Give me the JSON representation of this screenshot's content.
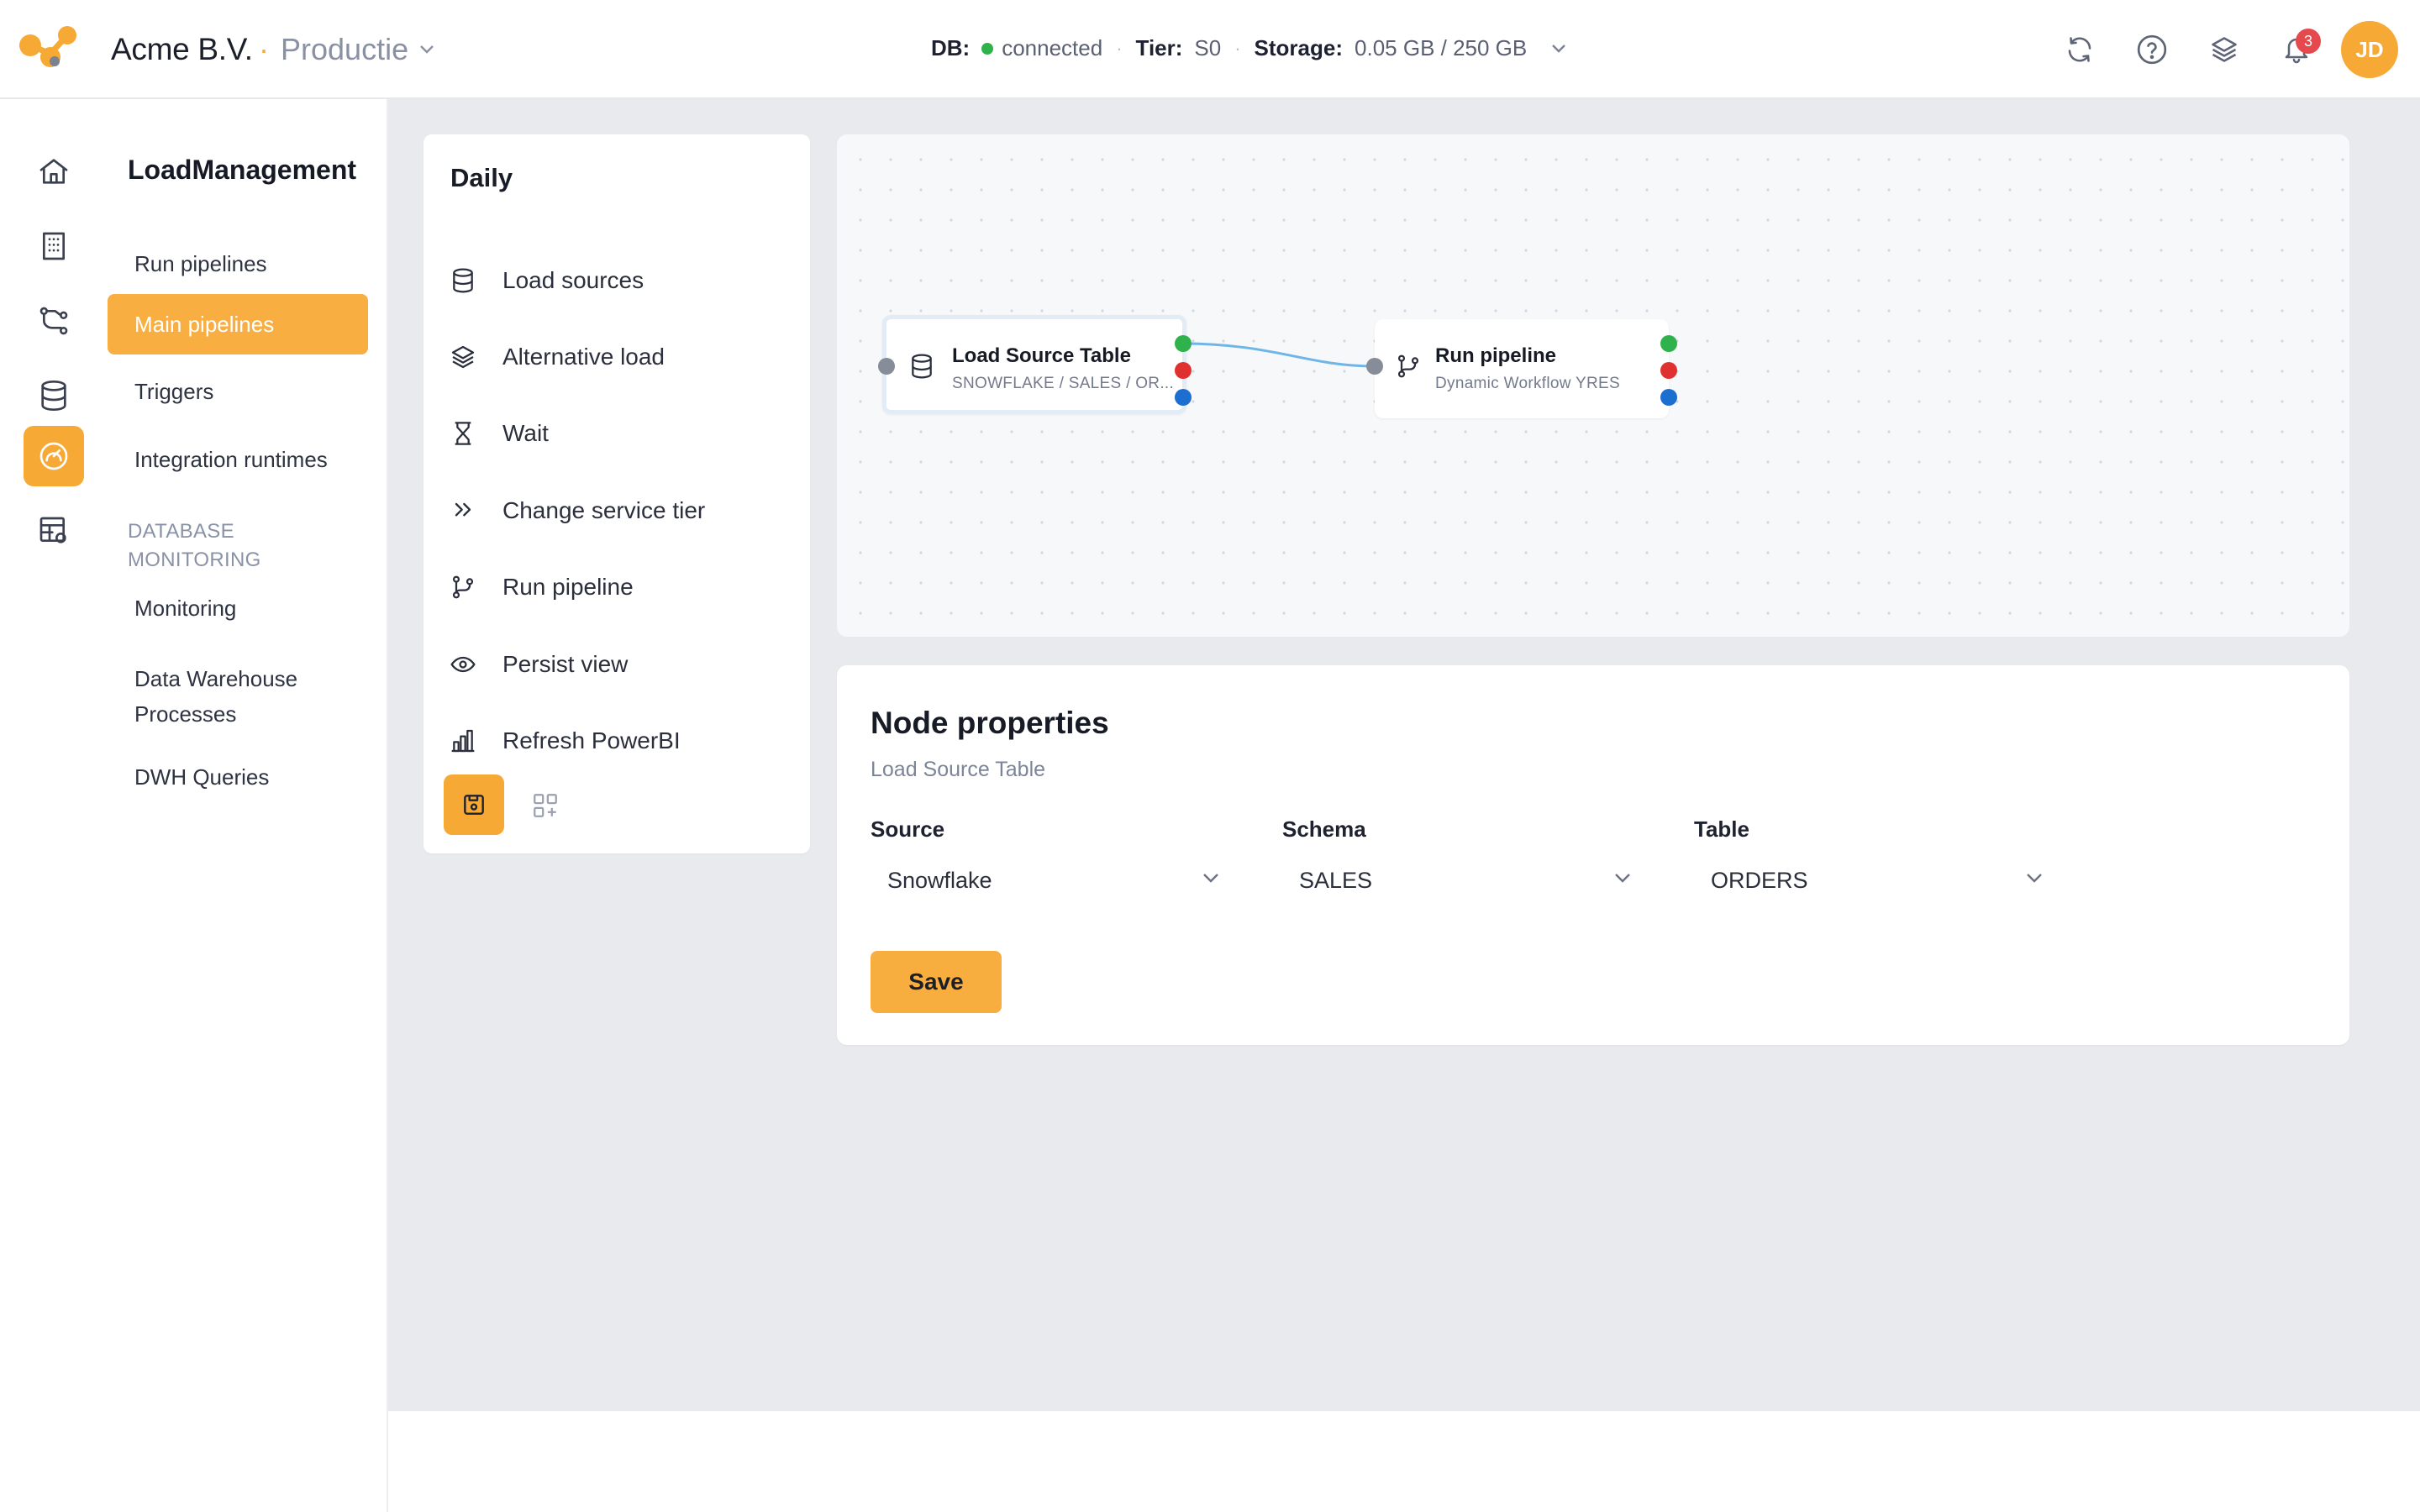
{
  "header": {
    "org_name": "Acme B.V.",
    "separator": "·",
    "environment": "Productie",
    "db_label": "DB:",
    "db_status": "connected",
    "tier_label": "Tier:",
    "tier_value": "S0",
    "storage_label": "Storage:",
    "storage_value": "0.05 GB / 250 GB",
    "dot_sep": "·",
    "notification_count": "3",
    "user_initials": "JD"
  },
  "rail": {
    "items": [
      "home-icon",
      "building-icon",
      "pipeline-graph-icon",
      "database-icon",
      "gauge-icon",
      "table-settings-icon"
    ],
    "active_index": 4
  },
  "subnav": {
    "title": "LoadManagement",
    "items": [
      {
        "label": "Run pipelines"
      },
      {
        "label": "Main pipelines",
        "active": true
      },
      {
        "label": "Triggers"
      },
      {
        "label": "Integration runtimes"
      }
    ],
    "section_title_line1": "DATABASE",
    "section_title_line2": "MONITORING",
    "section_items": [
      {
        "label": "Monitoring"
      },
      {
        "label_line1": "Data Warehouse",
        "label_line2": "Processes"
      },
      {
        "label": "DWH Queries"
      }
    ]
  },
  "palette": {
    "title": "Daily",
    "items": [
      {
        "label": "Load sources",
        "icon": "database-icon"
      },
      {
        "label": "Alternative load",
        "icon": "layers-icon"
      },
      {
        "label": "Wait",
        "icon": "hourglass-icon"
      },
      {
        "label": "Change service tier",
        "icon": "chevrons-right-icon"
      },
      {
        "label": "Run pipeline",
        "icon": "git-branch-icon"
      },
      {
        "label": "Persist view",
        "icon": "eye-icon"
      },
      {
        "label": "Refresh PowerBI",
        "icon": "bar-chart-icon"
      }
    ]
  },
  "canvas": {
    "nodes": [
      {
        "title": "Load Source Table",
        "subtitle": "SNOWFLAKE / SALES / OR...",
        "icon": "database-icon",
        "selected": true
      },
      {
        "title": "Run pipeline",
        "subtitle": "Dynamic Workflow YRES",
        "icon": "git-branch-icon",
        "selected": false
      }
    ],
    "port_colors": {
      "input": "#868c98",
      "success": "#2fb24c",
      "failure": "#e03131",
      "completion": "#1c6fd0"
    },
    "edge_color": "#6fb6e8"
  },
  "properties": {
    "title": "Node properties",
    "subtitle": "Load Source Table",
    "source_label": "Source",
    "source_value": "Snowflake",
    "schema_label": "Schema",
    "schema_value": "SALES",
    "table_label": "Table",
    "table_value": "ORDERS",
    "save_label": "Save"
  },
  "colors": {
    "accent": "#f6a935",
    "background": "#e9eaed",
    "text": "#1f2330"
  }
}
